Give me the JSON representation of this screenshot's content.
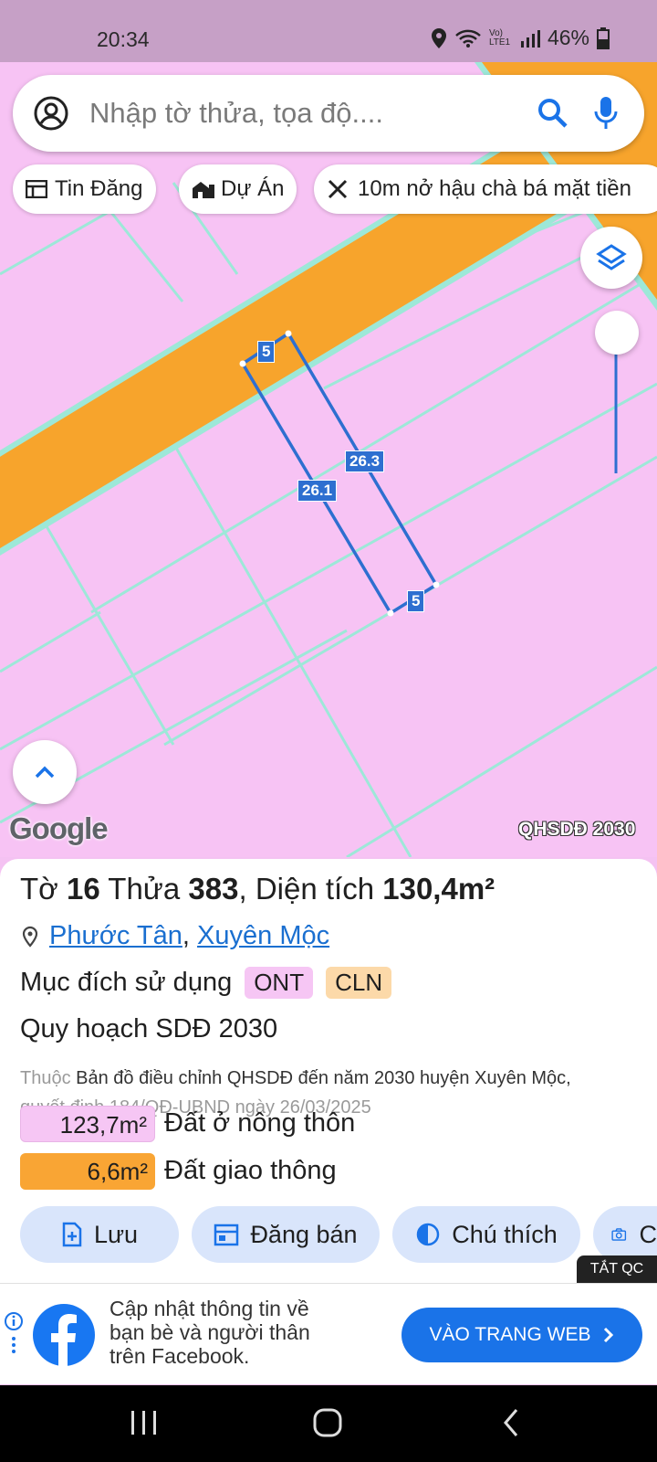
{
  "status": {
    "time": "20:34",
    "battery": "46%",
    "network": "Vo) LTE1"
  },
  "search": {
    "placeholder": "Nhập tờ thửa, tọa độ...."
  },
  "chips": [
    "Tin Đăng",
    "Dự Án",
    "10m nở hậu chà bá mặt tiền"
  ],
  "map": {
    "edge_labels": [
      "5",
      "26.3",
      "26.1",
      "5"
    ],
    "google": "Google",
    "layer_badge": "QHSDĐ 2030"
  },
  "parcel": {
    "sheet_label": "Tờ",
    "sheet": "16",
    "plot_label": "Thửa",
    "plot": "383",
    "area_label": ", Diện tích",
    "area": "130,4m²",
    "commune": "Phước Tân",
    "district": "Xuyên Mộc",
    "usage_label": "Mục đích sử dụng",
    "usage_tags": [
      "ONT",
      "CLN"
    ],
    "plan_title": "Quy hoạch SDĐ 2030",
    "source_prefix": "Thuộc",
    "source_name": "Bản đồ điều chỉnh QHSDĐ đến năm 2030 huyện Xuyên Mộc,",
    "decision": "quyết định 184/QĐ-UBND ngày 26/03/2025",
    "areas": [
      {
        "value": "123,7m²",
        "label": "Đất ở nông thôn",
        "color": "#f6c6f4"
      },
      {
        "value": "6,6m²",
        "label": "Đất giao thông",
        "color": "#f9a534"
      }
    ]
  },
  "actions": [
    "Lưu",
    "Đăng bán",
    "Chú thích",
    "C"
  ],
  "ad": {
    "close": "TẮT QC",
    "text": [
      "Cập nhật thông tin về",
      "bạn bè và người thân",
      "trên Facebook."
    ],
    "cta": "VÀO TRANG WEB"
  },
  "colors": {
    "road": "#f7a42c",
    "land": "#f7c3f4",
    "boundary": "#2e6fd0",
    "accent": "#1a73e8"
  }
}
